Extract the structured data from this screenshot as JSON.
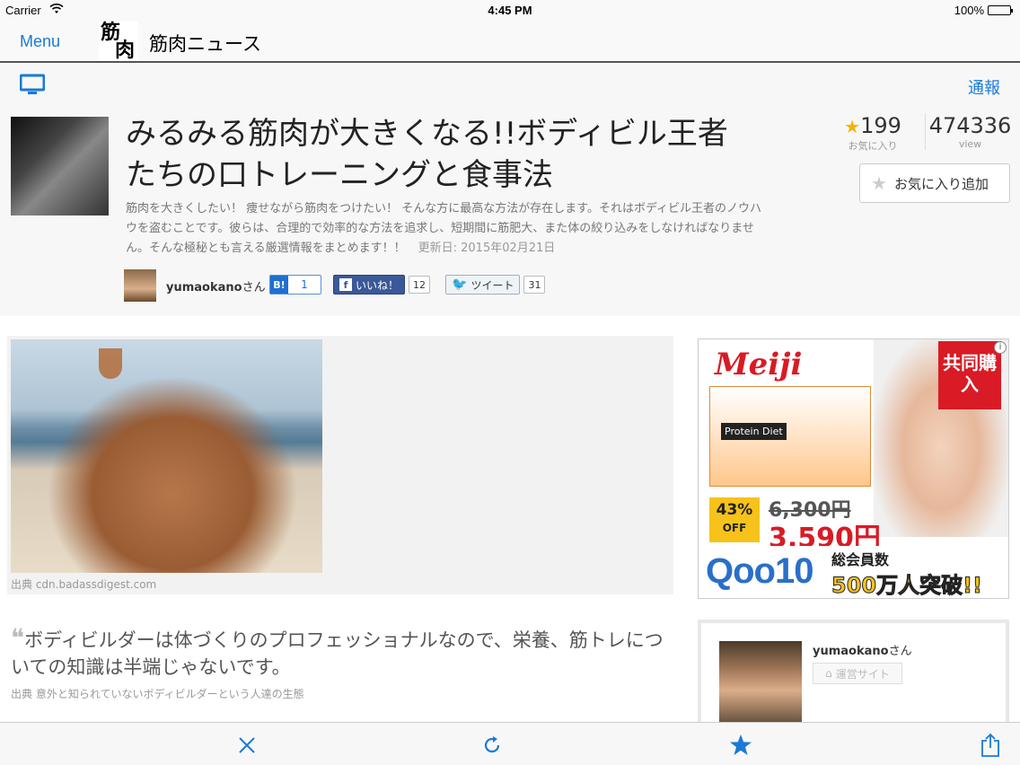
{
  "status": {
    "carrier": "Carrier",
    "time": "4:45 PM",
    "battery": "100%"
  },
  "nav": {
    "menu": "Menu",
    "logo_line1": "筋",
    "logo_line2": "肉",
    "site_name": "筋肉ニュース"
  },
  "subbar": {
    "report": "通報"
  },
  "article": {
    "title": "みるみる筋肉が大きくなる!!ボディビル王者たちの口トレーニングと食事法",
    "description": "筋肉を大きくしたい！ 痩せながら筋肉をつけたい！ そんな方に最高な方法が存在します。それはボディビル王者のノウハウを盗むことです。彼らは、合理的で効率的な方法を追求し、短期間に筋肥大、また体の絞り込みをしなければなりません。そんな極秘とも言える厳選情報をまとめます！！",
    "updated": "更新日: 2015年02月21日",
    "fav_count": "199",
    "fav_label": "お気に入り",
    "view_count": "474336",
    "view_label": "view",
    "fav_button": "お気に入り追加"
  },
  "author": {
    "name": "yumaokano",
    "suffix": "さん"
  },
  "social": {
    "hatena_icon": "B!",
    "hatena_count": "1",
    "facebook_label": "いいね！",
    "facebook_count": "12",
    "twitter_label": "ツイート",
    "twitter_count": "31"
  },
  "image_block": {
    "credit": "出典  cdn.badassdigest.com"
  },
  "quote": {
    "mark": "❝",
    "text": "ボディビルダーは体づくりのプロフェッショナルなので、栄養、筋トレについての知識は半端じゃないです。",
    "credit": "出典  意外と知られていないボディビルダーという人達の生態"
  },
  "ad": {
    "brand": "Meiji",
    "product": "Protein Diet",
    "group_buy": "共同購入",
    "off_pct": "43%",
    "off_label": "OFF",
    "old_price": "6,300円",
    "new_price": "3,590円",
    "store": "Qoo10",
    "members_label": "総会員数",
    "members_big": "500万人突破!!",
    "info": "i"
  },
  "author_card": {
    "name": "yumaokano",
    "suffix": "さん",
    "site_button": "運営サイト"
  },
  "colors": {
    "accent": "#1a7ad6",
    "star": "#f5b300"
  }
}
